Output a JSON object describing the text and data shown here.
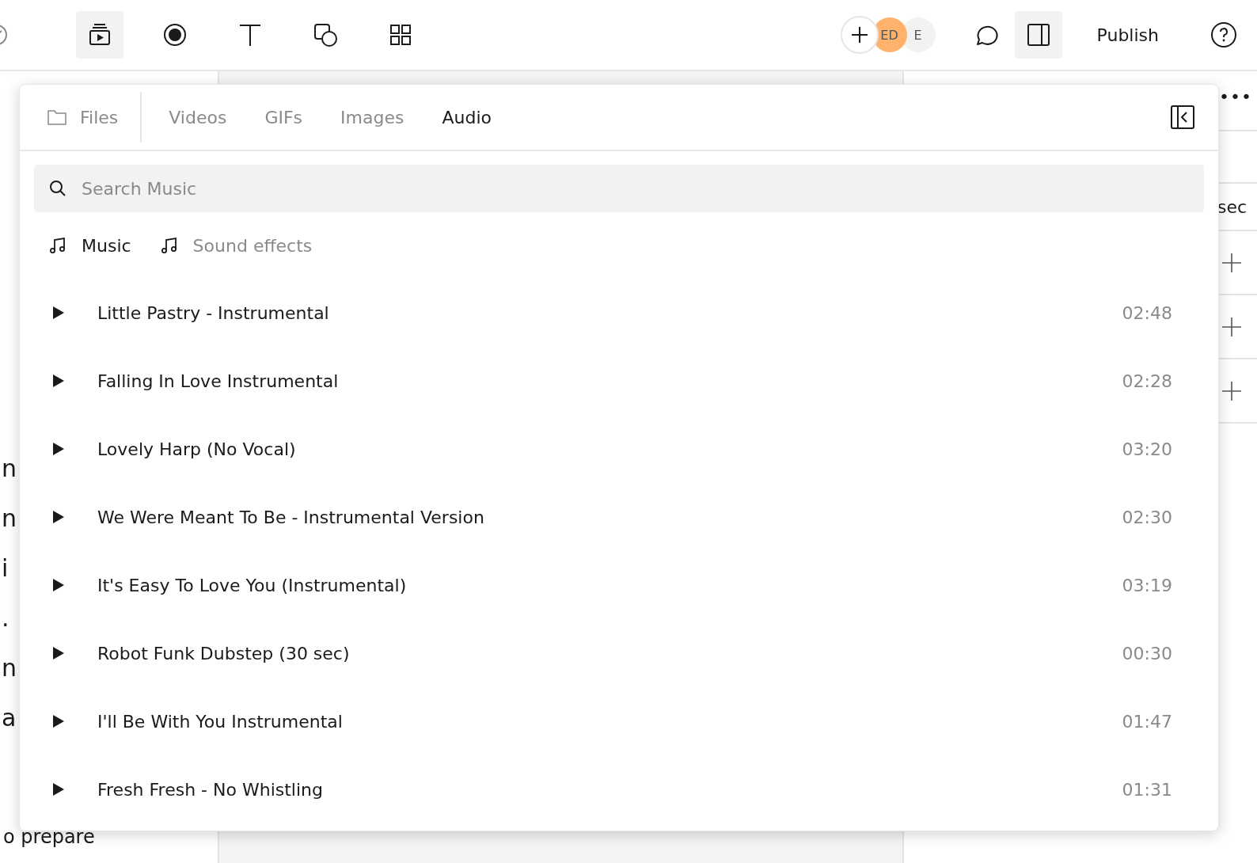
{
  "toolbar": {
    "tools": [
      {
        "kind": "media",
        "selected": true
      },
      {
        "kind": "record",
        "selected": false
      },
      {
        "kind": "text",
        "selected": false
      },
      {
        "kind": "shape",
        "selected": false
      },
      {
        "kind": "grid",
        "selected": false
      }
    ],
    "avatars": [
      {
        "initials": "ED",
        "color": "#ffb26b"
      },
      {
        "initials": "E",
        "color": "#f2f2f2"
      }
    ],
    "panel_toggle": {
      "selected": true
    },
    "publish": "Publish"
  },
  "background": {
    "left_lines": [
      "n",
      "n",
      "i",
      ".",
      "n",
      "a",
      "o prepare"
    ],
    "more": "•••",
    "right_label": "sec"
  },
  "media_panel": {
    "tabs": [
      {
        "label": "Files",
        "kind": "folder",
        "selected": false
      },
      {
        "label": "Videos",
        "selected": false
      },
      {
        "label": "GIFs",
        "selected": false
      },
      {
        "label": "Images",
        "selected": false
      },
      {
        "label": "Audio",
        "selected": true
      }
    ],
    "search": {
      "placeholder": "Search Music"
    },
    "categories": [
      {
        "label": "Music",
        "selected": true
      },
      {
        "label": "Sound effects",
        "selected": false
      }
    ],
    "tracks": [
      {
        "title": "Little Pastry - Instrumental",
        "duration": "02:48"
      },
      {
        "title": "Falling In Love Instrumental",
        "duration": "02:28"
      },
      {
        "title": "Lovely Harp (No Vocal)",
        "duration": "03:20"
      },
      {
        "title": "We Were Meant To Be - Instrumental Version",
        "duration": "02:30"
      },
      {
        "title": "It's Easy To Love You (Instrumental)",
        "duration": "03:19"
      },
      {
        "title": "Robot Funk Dubstep (30 sec)",
        "duration": "00:30"
      },
      {
        "title": "I'll Be With You Instrumental",
        "duration": "01:47"
      },
      {
        "title": "Fresh Fresh - No Whistling",
        "duration": "01:31"
      }
    ]
  }
}
